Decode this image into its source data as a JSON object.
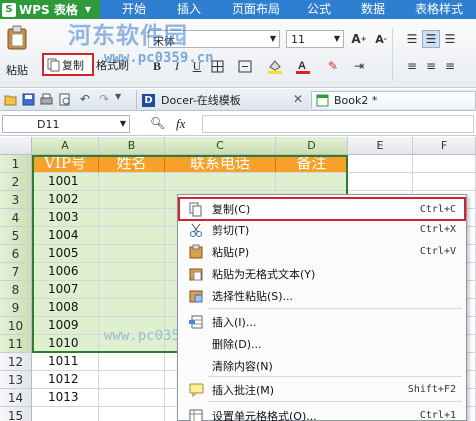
{
  "titlebar": {
    "app_menu": "WPS 表格",
    "tabs": [
      "开始",
      "插入",
      "页面布局",
      "公式",
      "数据",
      "表格样式"
    ]
  },
  "ribbon": {
    "paste_label": "粘贴",
    "copy_label": "复制",
    "format_painter_label": "格式刷",
    "font_name": "宋体",
    "font_size": "11",
    "bold": "B",
    "italic": "I",
    "underline": "U"
  },
  "tabs_bar": {
    "doc_tabs": [
      "Docer-在线模板",
      "Book2 *"
    ]
  },
  "formula_bar": {
    "name_box": "D11",
    "fx": "fx"
  },
  "sheet": {
    "columns": [
      "A",
      "B",
      "C",
      "D",
      "E",
      "F"
    ],
    "rows": [
      "1",
      "2",
      "3",
      "4",
      "5",
      "6",
      "7",
      "8",
      "9",
      "10",
      "11",
      "12",
      "13",
      "14",
      "15"
    ],
    "headers": [
      "VIP号",
      "姓名",
      "联系电话",
      "备注"
    ],
    "vip_numbers": [
      "1001",
      "1002",
      "1003",
      "1004",
      "1005",
      "1006",
      "1007",
      "1008",
      "1009",
      "1010",
      "1011",
      "1012",
      "1013"
    ]
  },
  "context_menu": [
    {
      "label": "复制(C)",
      "shortcut": "Ctrl+C",
      "icon": "copy-icon"
    },
    {
      "label": "剪切(T)",
      "shortcut": "Ctrl+X",
      "icon": "scissors-icon"
    },
    {
      "label": "粘贴(P)",
      "shortcut": "Ctrl+V",
      "icon": "paste-icon"
    },
    {
      "label": "粘贴为无格式文本(Y)",
      "shortcut": "",
      "icon": "paste-text-icon"
    },
    {
      "label": "选择性粘贴(S)...",
      "shortcut": "",
      "icon": "paste-special-icon"
    },
    {
      "label": "插入(I)...",
      "shortcut": "",
      "icon": "insert-cells-icon"
    },
    {
      "label": "删除(D)...",
      "shortcut": "",
      "icon": ""
    },
    {
      "label": "清除内容(N)",
      "shortcut": "",
      "icon": ""
    },
    {
      "label": "插入批注(M)",
      "shortcut": "Shift+F2",
      "icon": "comment-icon"
    },
    {
      "label": "设置单元格格式(O)...",
      "shortcut": "Ctrl+1",
      "icon": "format-cells-icon"
    }
  ],
  "watermark": {
    "line1": "河东软件园",
    "line2": "www.pc0359.cn",
    "line3": "www.pc0359.cn"
  },
  "colors": {
    "header_orange": "#f7a12a",
    "selection_green": "#dff0d0",
    "highlight_red": "#d0262b",
    "title_blue": "#2f7fd0"
  }
}
